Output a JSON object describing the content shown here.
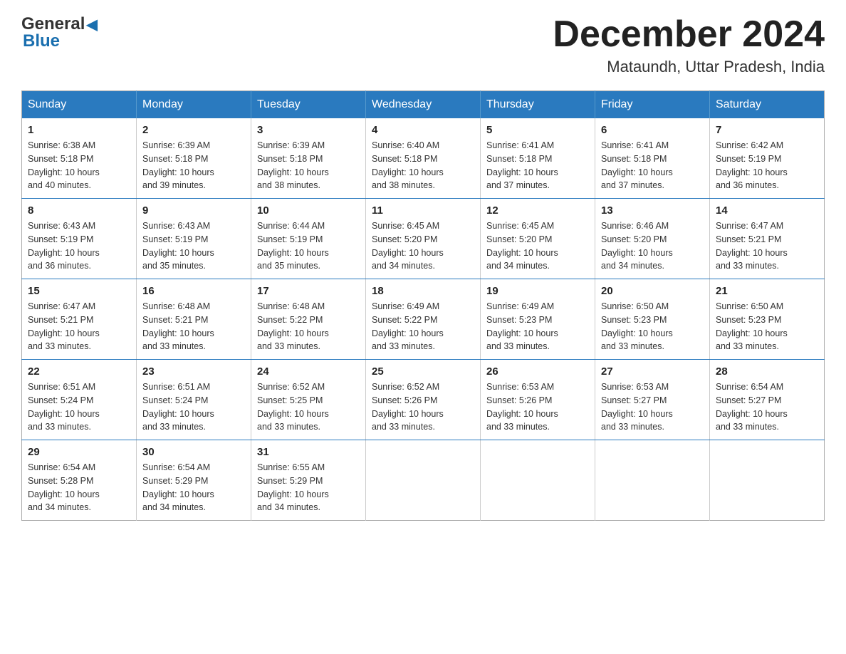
{
  "header": {
    "logo_general": "General",
    "logo_blue": "Blue",
    "month_title": "December 2024",
    "location": "Mataundh, Uttar Pradesh, India"
  },
  "days_of_week": [
    "Sunday",
    "Monday",
    "Tuesday",
    "Wednesday",
    "Thursday",
    "Friday",
    "Saturday"
  ],
  "weeks": [
    [
      {
        "day": "1",
        "sunrise": "6:38 AM",
        "sunset": "5:18 PM",
        "daylight": "10 hours and 40 minutes."
      },
      {
        "day": "2",
        "sunrise": "6:39 AM",
        "sunset": "5:18 PM",
        "daylight": "10 hours and 39 minutes."
      },
      {
        "day": "3",
        "sunrise": "6:39 AM",
        "sunset": "5:18 PM",
        "daylight": "10 hours and 38 minutes."
      },
      {
        "day": "4",
        "sunrise": "6:40 AM",
        "sunset": "5:18 PM",
        "daylight": "10 hours and 38 minutes."
      },
      {
        "day": "5",
        "sunrise": "6:41 AM",
        "sunset": "5:18 PM",
        "daylight": "10 hours and 37 minutes."
      },
      {
        "day": "6",
        "sunrise": "6:41 AM",
        "sunset": "5:18 PM",
        "daylight": "10 hours and 37 minutes."
      },
      {
        "day": "7",
        "sunrise": "6:42 AM",
        "sunset": "5:19 PM",
        "daylight": "10 hours and 36 minutes."
      }
    ],
    [
      {
        "day": "8",
        "sunrise": "6:43 AM",
        "sunset": "5:19 PM",
        "daylight": "10 hours and 36 minutes."
      },
      {
        "day": "9",
        "sunrise": "6:43 AM",
        "sunset": "5:19 PM",
        "daylight": "10 hours and 35 minutes."
      },
      {
        "day": "10",
        "sunrise": "6:44 AM",
        "sunset": "5:19 PM",
        "daylight": "10 hours and 35 minutes."
      },
      {
        "day": "11",
        "sunrise": "6:45 AM",
        "sunset": "5:20 PM",
        "daylight": "10 hours and 34 minutes."
      },
      {
        "day": "12",
        "sunrise": "6:45 AM",
        "sunset": "5:20 PM",
        "daylight": "10 hours and 34 minutes."
      },
      {
        "day": "13",
        "sunrise": "6:46 AM",
        "sunset": "5:20 PM",
        "daylight": "10 hours and 34 minutes."
      },
      {
        "day": "14",
        "sunrise": "6:47 AM",
        "sunset": "5:21 PM",
        "daylight": "10 hours and 33 minutes."
      }
    ],
    [
      {
        "day": "15",
        "sunrise": "6:47 AM",
        "sunset": "5:21 PM",
        "daylight": "10 hours and 33 minutes."
      },
      {
        "day": "16",
        "sunrise": "6:48 AM",
        "sunset": "5:21 PM",
        "daylight": "10 hours and 33 minutes."
      },
      {
        "day": "17",
        "sunrise": "6:48 AM",
        "sunset": "5:22 PM",
        "daylight": "10 hours and 33 minutes."
      },
      {
        "day": "18",
        "sunrise": "6:49 AM",
        "sunset": "5:22 PM",
        "daylight": "10 hours and 33 minutes."
      },
      {
        "day": "19",
        "sunrise": "6:49 AM",
        "sunset": "5:23 PM",
        "daylight": "10 hours and 33 minutes."
      },
      {
        "day": "20",
        "sunrise": "6:50 AM",
        "sunset": "5:23 PM",
        "daylight": "10 hours and 33 minutes."
      },
      {
        "day": "21",
        "sunrise": "6:50 AM",
        "sunset": "5:23 PM",
        "daylight": "10 hours and 33 minutes."
      }
    ],
    [
      {
        "day": "22",
        "sunrise": "6:51 AM",
        "sunset": "5:24 PM",
        "daylight": "10 hours and 33 minutes."
      },
      {
        "day": "23",
        "sunrise": "6:51 AM",
        "sunset": "5:24 PM",
        "daylight": "10 hours and 33 minutes."
      },
      {
        "day": "24",
        "sunrise": "6:52 AM",
        "sunset": "5:25 PM",
        "daylight": "10 hours and 33 minutes."
      },
      {
        "day": "25",
        "sunrise": "6:52 AM",
        "sunset": "5:26 PM",
        "daylight": "10 hours and 33 minutes."
      },
      {
        "day": "26",
        "sunrise": "6:53 AM",
        "sunset": "5:26 PM",
        "daylight": "10 hours and 33 minutes."
      },
      {
        "day": "27",
        "sunrise": "6:53 AM",
        "sunset": "5:27 PM",
        "daylight": "10 hours and 33 minutes."
      },
      {
        "day": "28",
        "sunrise": "6:54 AM",
        "sunset": "5:27 PM",
        "daylight": "10 hours and 33 minutes."
      }
    ],
    [
      {
        "day": "29",
        "sunrise": "6:54 AM",
        "sunset": "5:28 PM",
        "daylight": "10 hours and 34 minutes."
      },
      {
        "day": "30",
        "sunrise": "6:54 AM",
        "sunset": "5:29 PM",
        "daylight": "10 hours and 34 minutes."
      },
      {
        "day": "31",
        "sunrise": "6:55 AM",
        "sunset": "5:29 PM",
        "daylight": "10 hours and 34 minutes."
      },
      null,
      null,
      null,
      null
    ]
  ],
  "labels": {
    "sunrise": "Sunrise:",
    "sunset": "Sunset:",
    "daylight": "Daylight:"
  }
}
